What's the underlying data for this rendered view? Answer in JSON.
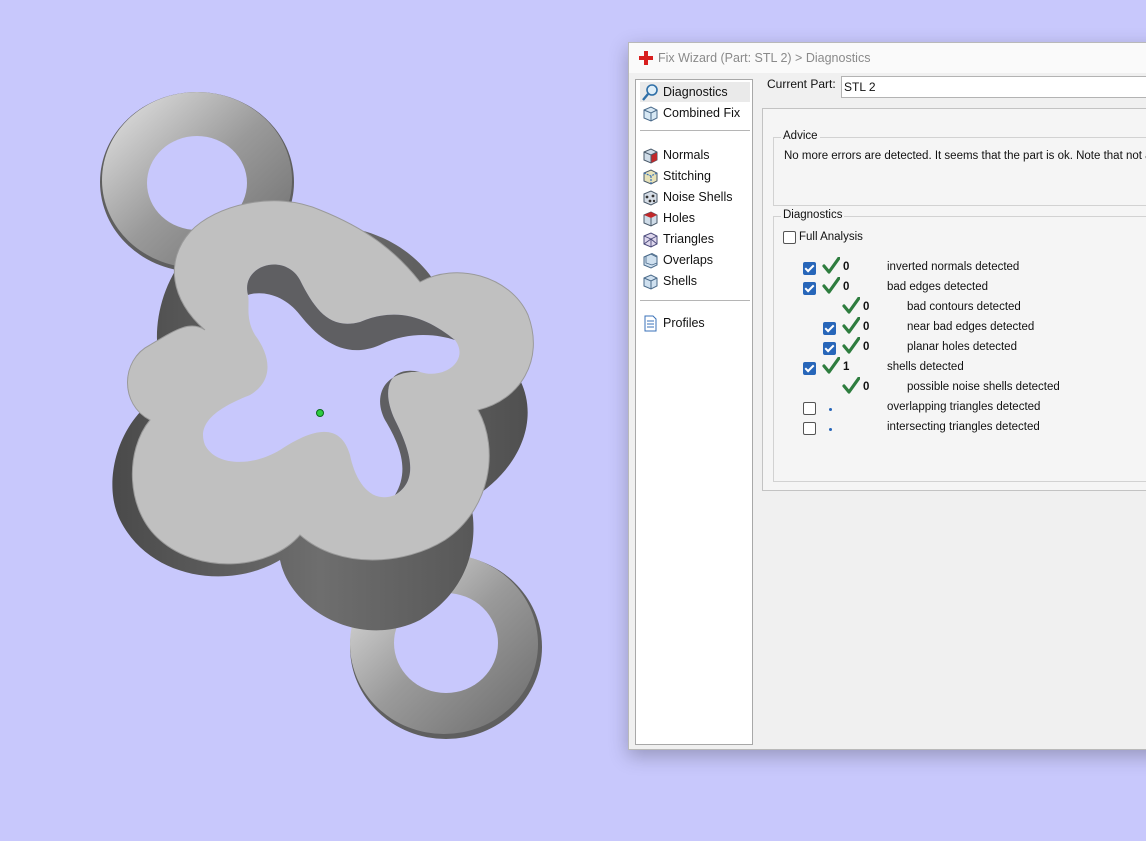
{
  "dialog": {
    "title": "Fix Wizard (Part: STL 2) > Diagnostics",
    "nav": {
      "items": [
        {
          "label": "Diagnostics",
          "icon": "magnifier-icon",
          "selected": true
        },
        {
          "label": "Combined Fix",
          "icon": "cube-icon"
        },
        {
          "label": "Normals",
          "icon": "normals-cube-icon"
        },
        {
          "label": "Stitching",
          "icon": "stitching-cube-icon"
        },
        {
          "label": "Noise Shells",
          "icon": "noise-shells-icon"
        },
        {
          "label": "Holes",
          "icon": "holes-cube-icon"
        },
        {
          "label": "Triangles",
          "icon": "triangles-cube-icon"
        },
        {
          "label": "Overlaps",
          "icon": "overlaps-cube-icon"
        },
        {
          "label": "Shells",
          "icon": "shells-cube-icon"
        },
        {
          "label": "Profiles",
          "icon": "document-icon"
        }
      ]
    },
    "current_part": {
      "label": "Current Part:",
      "value": "STL 2"
    },
    "advice": {
      "title": "Advice",
      "text": "No more errors are detected. It seems that the part is ok. Note that not all"
    },
    "diagnostics": {
      "title": "Diagnostics",
      "full_analysis": {
        "label": "Full Analysis",
        "checked": false
      },
      "rows": [
        {
          "checked": true,
          "status": "ok",
          "count": "0",
          "label": "inverted normals detected",
          "indent": 0
        },
        {
          "checked": true,
          "status": "ok",
          "count": "0",
          "label": "bad edges detected",
          "indent": 0
        },
        {
          "checkbox": false,
          "status": "ok",
          "count": "0",
          "label": "bad contours detected",
          "indent": 1
        },
        {
          "checked": true,
          "status": "ok",
          "count": "0",
          "label": "near bad edges detected",
          "indent": 1
        },
        {
          "checked": true,
          "status": "ok",
          "count": "0",
          "label": "planar holes detected",
          "indent": 1
        },
        {
          "checked": true,
          "status": "ok",
          "count": "1",
          "label": "shells detected",
          "indent": 0
        },
        {
          "checkbox": false,
          "status": "ok",
          "count": "0",
          "label": "possible noise shells detected",
          "indent": 1
        },
        {
          "checked": false,
          "status": "dot",
          "count": "",
          "label": "overlapping triangles detected",
          "indent": 0
        },
        {
          "checked": false,
          "status": "dot",
          "count": "",
          "label": "intersecting triangles detected",
          "indent": 0
        }
      ]
    }
  },
  "colors": {
    "background": "#c8c8fc",
    "check_green": "#2e7d3f",
    "checkbox_blue": "#2766b9",
    "model_top": "#c0c0c0",
    "model_side": "#5a5a5a"
  }
}
